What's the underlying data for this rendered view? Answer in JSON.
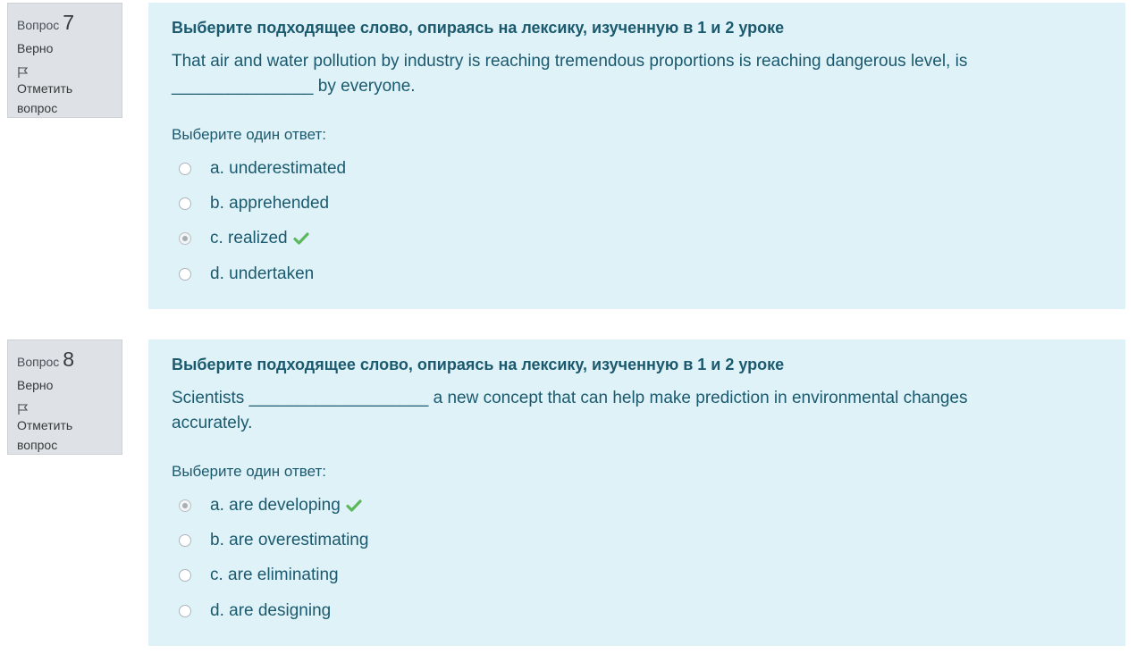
{
  "questions": [
    {
      "label": "Вопрос",
      "number": "7",
      "state": "Верно",
      "flag_label": "Отметить вопрос",
      "title": "Выберите подходящее слово, опираясь на лексику, изученную в 1 и 2 уроке",
      "text_line1": "That air and water pollution by industry is reaching tremendous proportions is reaching dangerous level, is",
      "text_line2": "_______________ by everyone.",
      "prompt": "Выберите один ответ:",
      "answers": [
        {
          "label": "a. underestimated",
          "selected": false,
          "correct": false
        },
        {
          "label": "b. apprehended",
          "selected": false,
          "correct": false
        },
        {
          "label": "c. realized",
          "selected": true,
          "correct": true
        },
        {
          "label": "d. undertaken",
          "selected": false,
          "correct": false
        }
      ]
    },
    {
      "label": "Вопрос",
      "number": "8",
      "state": "Верно",
      "flag_label": "Отметить вопрос",
      "title": "Выберите подходящее слово, опираясь на лексику, изученную в 1 и 2 уроке",
      "text_line1": "Scientists ___________________ a new concept that can help make prediction in environmental changes",
      "text_line2": "accurately.",
      "prompt": "Выберите один ответ:",
      "answers": [
        {
          "label": "a. are developing",
          "selected": true,
          "correct": true
        },
        {
          "label": "b. are overestimating",
          "selected": false,
          "correct": false
        },
        {
          "label": "c. are eliminating",
          "selected": false,
          "correct": false
        },
        {
          "label": "d. are designing",
          "selected": false,
          "correct": false
        }
      ]
    }
  ],
  "colors": {
    "content_bg": "#def2f8",
    "info_bg": "#dee2e6",
    "text": "#1b5a6e",
    "check": "#5cb85c"
  }
}
